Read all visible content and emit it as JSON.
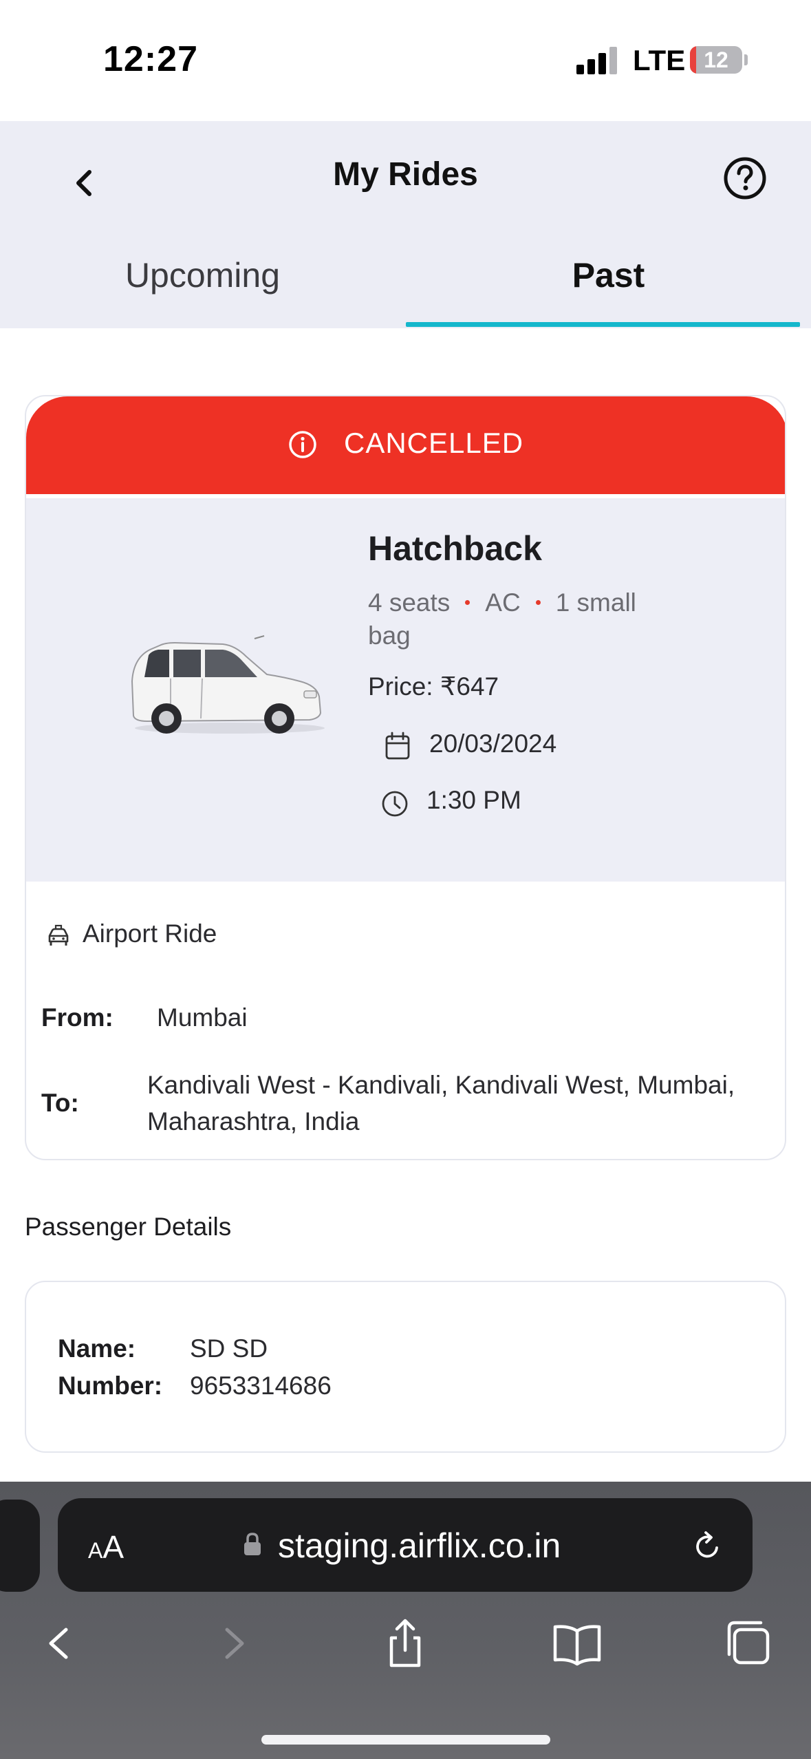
{
  "status_bar": {
    "time": "12:27",
    "network": "LTE",
    "battery_level": "12",
    "battery_fraction": 0.12
  },
  "header": {
    "title": "My Rides",
    "back_icon": "chevron-left-icon",
    "help_icon": "question-circle-icon",
    "tabs": [
      {
        "label": "Upcoming",
        "active": false
      },
      {
        "label": "Past",
        "active": true
      }
    ],
    "accent_color": "#15b7cc"
  },
  "ride": {
    "status": "CANCELLED",
    "status_color": "#ee3125",
    "car_type": "Hatchback",
    "features": [
      "4 seats",
      "AC",
      "1 small bag"
    ],
    "price": "Price: ₹647",
    "date": "20/03/2024",
    "time": "1:30 PM",
    "ride_kind": "Airport Ride",
    "from_label": "From:",
    "from": "Mumbai",
    "to_label": "To:",
    "to": "Kandivali West - Kandivali, Kandivali West, Mumbai, Maharashtra, India"
  },
  "passenger": {
    "section_title": "Passenger Details",
    "name_label": "Name:",
    "name": "SD SD",
    "number_label": "Number:",
    "number": "9653314686"
  },
  "browser": {
    "text_size_small": "A",
    "text_size_big": "A",
    "url": "staging.airflix.co.in",
    "toolbar": [
      "back-icon",
      "forward-icon",
      "share-icon",
      "bookmarks-icon",
      "tabs-icon"
    ]
  }
}
